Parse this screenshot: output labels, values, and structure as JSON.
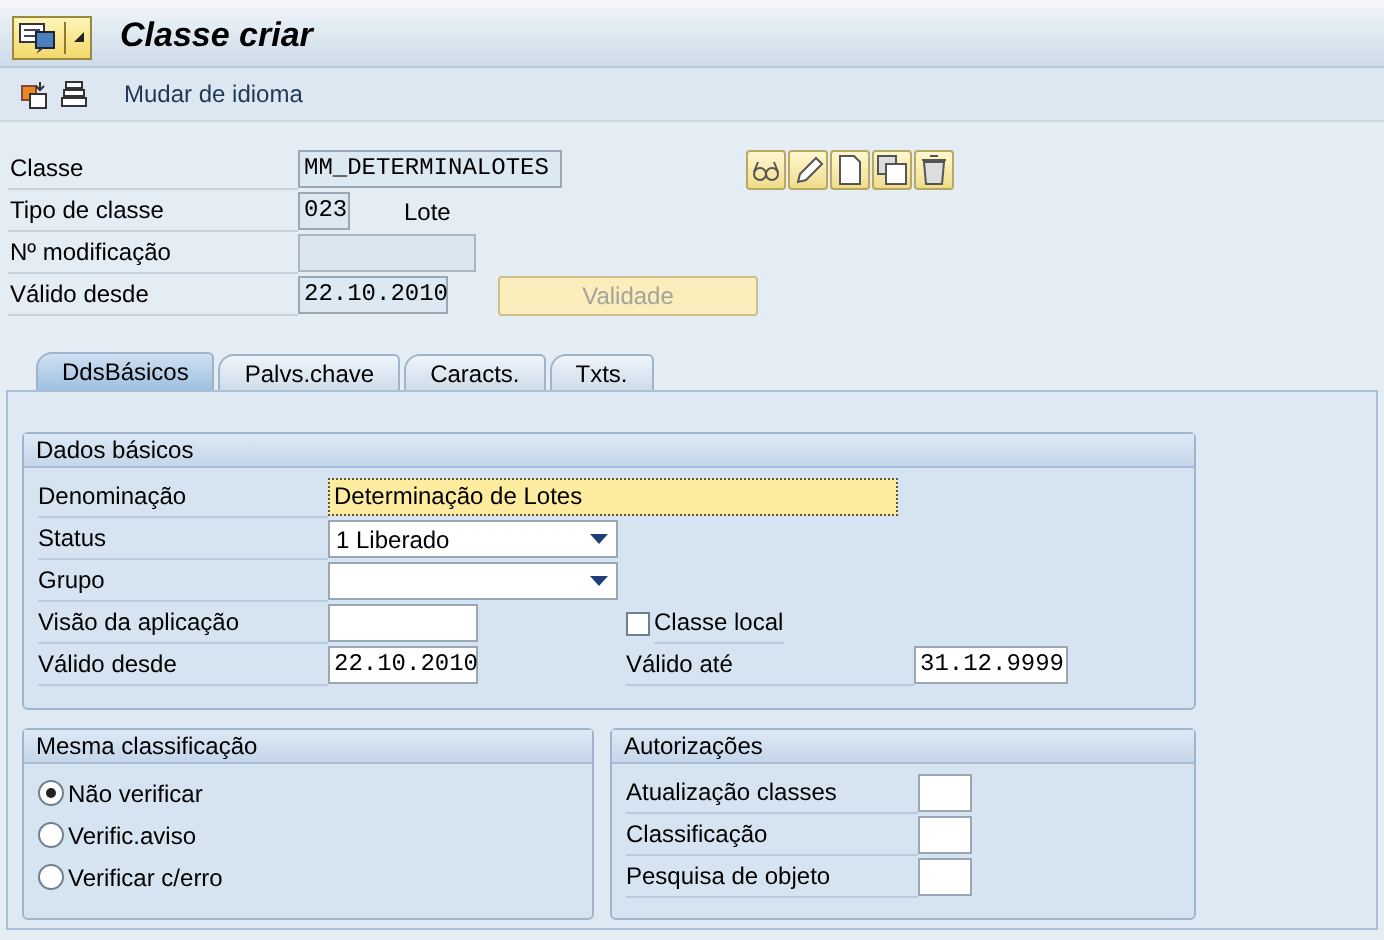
{
  "title": "Classe criar",
  "toolbar": {
    "button": "Mudar de idioma"
  },
  "header": {
    "fields": [
      {
        "label": "Classe",
        "value": "MM_DETERMINALOTES",
        "disabled": false
      },
      {
        "label": "Tipo de classe",
        "value": "023",
        "note": "Lote",
        "disabled": false
      },
      {
        "label": "Nº modificação",
        "disabled": true
      },
      {
        "label": "Válido desde",
        "value": "22.10.2010",
        "disabled": false
      }
    ],
    "validity_button": {
      "label": "Validade",
      "disabled": true
    }
  },
  "tabs": [
    {
      "label": "DdsBásicos",
      "selected": true
    },
    {
      "label": "Palvs.chave",
      "selected": false
    },
    {
      "label": "Caracts.",
      "selected": false
    },
    {
      "label": "Txts.",
      "selected": false
    }
  ],
  "basic_data": {
    "title": "Dados básicos",
    "denomination": {
      "label": "Denominação",
      "value": "Determinação de Lotes",
      "focused": true
    },
    "status": {
      "label": "Status",
      "value": "1 Liberado"
    },
    "group": {
      "label": "Grupo"
    },
    "application_view": {
      "label": "Visão da aplicação"
    },
    "local_class": {
      "label": "Classe local",
      "checked": false
    },
    "valid_from": {
      "label": "Válido desde",
      "value": "22.10.2010"
    },
    "valid_to": {
      "label": "Válido até",
      "value": "31.12.9999"
    }
  },
  "same_classification": {
    "title": "Mesma classificação",
    "options": [
      {
        "label": "Não verificar",
        "selected": true
      },
      {
        "label": "Verific.aviso",
        "selected": false
      },
      {
        "label": "Verificar c/erro",
        "selected": false
      }
    ]
  },
  "authorizations": {
    "title": "Autorizações",
    "fields": [
      {
        "label": "Atualização classes"
      },
      {
        "label": "Classificação"
      },
      {
        "label": "Pesquisa de objeto"
      }
    ]
  }
}
